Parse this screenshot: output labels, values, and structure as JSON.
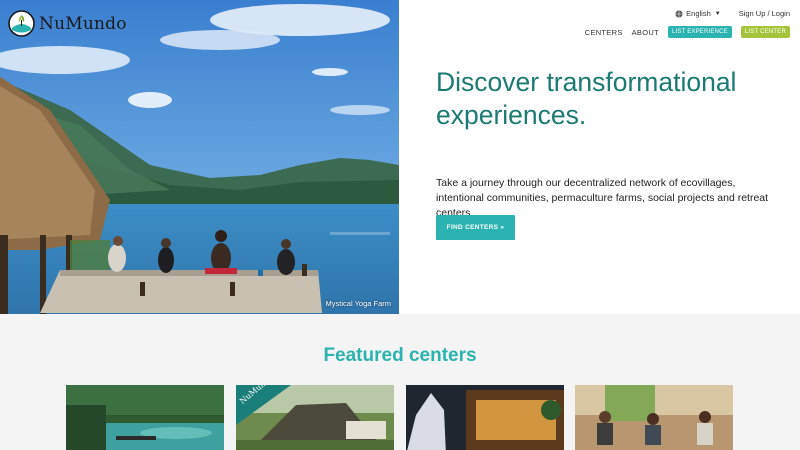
{
  "brand": {
    "name": "NuMundo"
  },
  "hero": {
    "photo_caption": "Mystical Yoga Farm",
    "headline": "Discover transformational experiences.",
    "subtext": "Take a journey through our decentralized network of ecovillages, intentional communities, permaculture farms, social projects and retreat centers.",
    "cta_label": "FIND CENTERS »"
  },
  "topbar": {
    "language": "English",
    "auth_link": "Sign Up / Login"
  },
  "nav": {
    "centers": "CENTERS",
    "about": "ABOUT",
    "list_experience": "LIST EXPERIENCE",
    "list_center": "LIST CENTER"
  },
  "featured": {
    "title": "Featured centers",
    "cards": [
      {
        "badge": ""
      },
      {
        "badge": "NuMundo"
      },
      {
        "badge": ""
      },
      {
        "badge": ""
      }
    ]
  },
  "colors": {
    "brand_teal": "#2bb3b1",
    "headline_teal": "#1b7a73",
    "lime": "#a5c43b"
  }
}
